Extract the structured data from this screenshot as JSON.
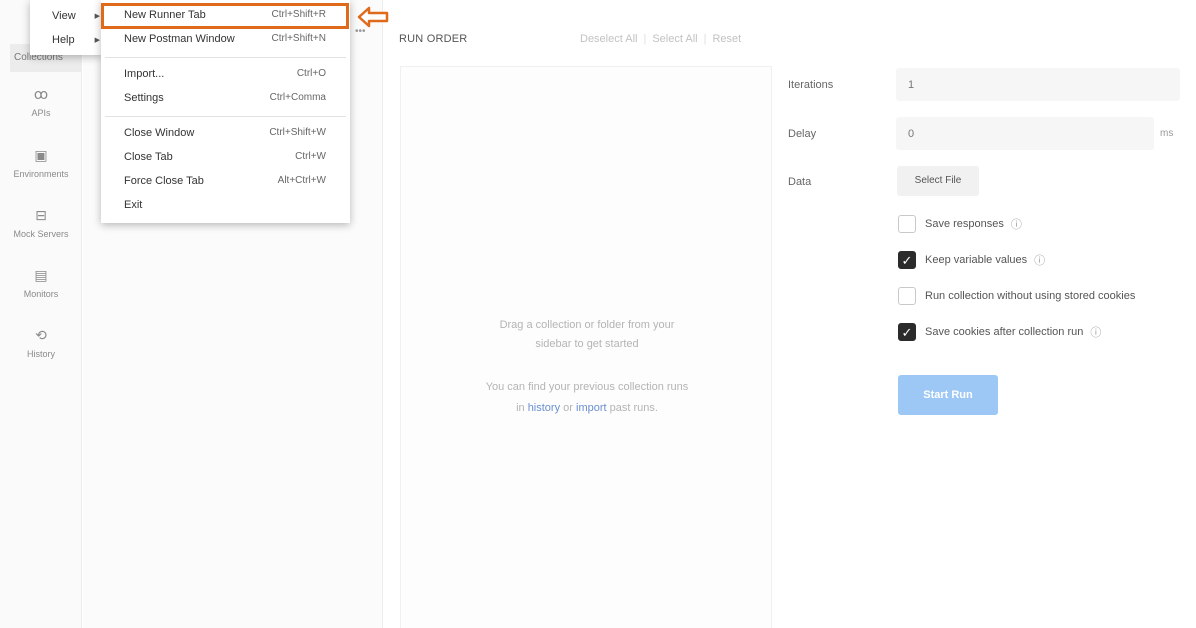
{
  "leftnav": {
    "top_item": "Collections",
    "items": [
      {
        "icon": "apis-icon",
        "glyph": "ꝏ",
        "label": "APIs"
      },
      {
        "icon": "environments-icon",
        "glyph": "▣",
        "label": "Environments"
      },
      {
        "icon": "mock-servers-icon",
        "glyph": "⊟",
        "label": "Mock Servers"
      },
      {
        "icon": "monitors-icon",
        "glyph": "▤",
        "label": "Monitors"
      },
      {
        "icon": "history-icon",
        "glyph": "⟲",
        "label": "History"
      }
    ]
  },
  "menu_left": {
    "view": "View",
    "help": "Help",
    "arrow": "▶"
  },
  "menu_right": {
    "items": [
      {
        "label": "New Runner Tab",
        "shortcut": "Ctrl+Shift+R"
      },
      {
        "label": "New Postman Window",
        "shortcut": "Ctrl+Shift+N"
      },
      {
        "label": "Import...",
        "shortcut": "Ctrl+O"
      },
      {
        "label": "Settings",
        "shortcut": "Ctrl+Comma"
      },
      {
        "label": "Close Window",
        "shortcut": "Ctrl+Shift+W"
      },
      {
        "label": "Close Tab",
        "shortcut": "Ctrl+W"
      },
      {
        "label": "Force Close Tab",
        "shortcut": "Alt+Ctrl+W"
      },
      {
        "label": "Exit",
        "shortcut": ""
      }
    ]
  },
  "runner": {
    "tab_more": "•••",
    "run_order_title": "RUN ORDER",
    "deselect_all": "Deselect All",
    "select_all": "Select All",
    "reset": "Reset",
    "action_sep": "|",
    "drop_line1": "Drag a collection or folder from your",
    "drop_line2": "sidebar to get started",
    "drop_line3": "You can find your previous collection runs",
    "drop_in": "in",
    "drop_history": "history",
    "drop_or": "or",
    "drop_import": "import",
    "drop_past": "past runs.",
    "iterations_label": "Iterations",
    "iterations_value": "1",
    "delay_label": "Delay",
    "delay_value": "0",
    "delay_unit": "ms",
    "data_label": "Data",
    "select_file": "Select File",
    "save_responses": "Save responses",
    "keep_variable_values": "Keep variable values",
    "run_without_cookies": "Run collection without using stored cookies",
    "save_cookies": "Save cookies after collection run",
    "info_glyph": "ⓘ",
    "check_glyph": "✓",
    "start_run": "Start Run"
  },
  "checks": {
    "save_responses": false,
    "keep_variable_values": true,
    "run_without_cookies": false,
    "save_cookies": true
  },
  "colors": {
    "highlight": "#e06a1c",
    "start_run": "#9dc8f5",
    "link": "#6b8fcf"
  }
}
